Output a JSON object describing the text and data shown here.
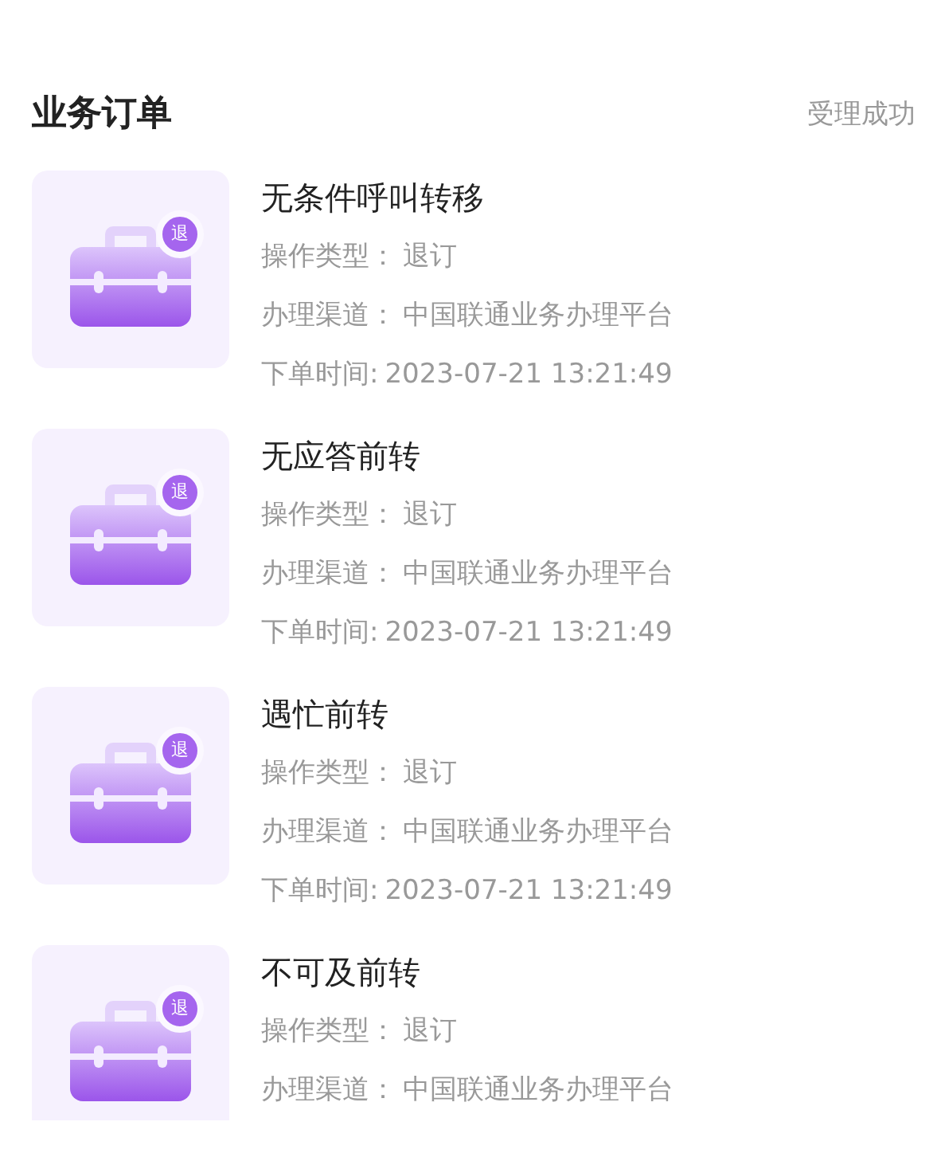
{
  "header": {
    "title": "业务订单",
    "status": "受理成功"
  },
  "orders": [
    {
      "title": "无条件呼叫转移",
      "badge": "退",
      "fields": [
        {
          "label": "操作类型：",
          "value": "退订"
        },
        {
          "label": "办理渠道：",
          "value": "中国联通业务办理平台"
        },
        {
          "label": "下单时间:",
          "value": "2023-07-21 13:21:49"
        }
      ]
    },
    {
      "title": "无应答前转",
      "badge": "退",
      "fields": [
        {
          "label": "操作类型：",
          "value": "退订"
        },
        {
          "label": "办理渠道：",
          "value": "中国联通业务办理平台"
        },
        {
          "label": "下单时间:",
          "value": "2023-07-21 13:21:49"
        }
      ]
    },
    {
      "title": "遇忙前转",
      "badge": "退",
      "fields": [
        {
          "label": "操作类型：",
          "value": "退订"
        },
        {
          "label": "办理渠道：",
          "value": "中国联通业务办理平台"
        },
        {
          "label": "下单时间:",
          "value": "2023-07-21 13:21:49"
        }
      ]
    },
    {
      "title": "不可及前转",
      "badge": "退",
      "fields": [
        {
          "label": "操作类型：",
          "value": "退订"
        },
        {
          "label": "办理渠道：",
          "value": "中国联通业务办理平台"
        }
      ]
    }
  ]
}
